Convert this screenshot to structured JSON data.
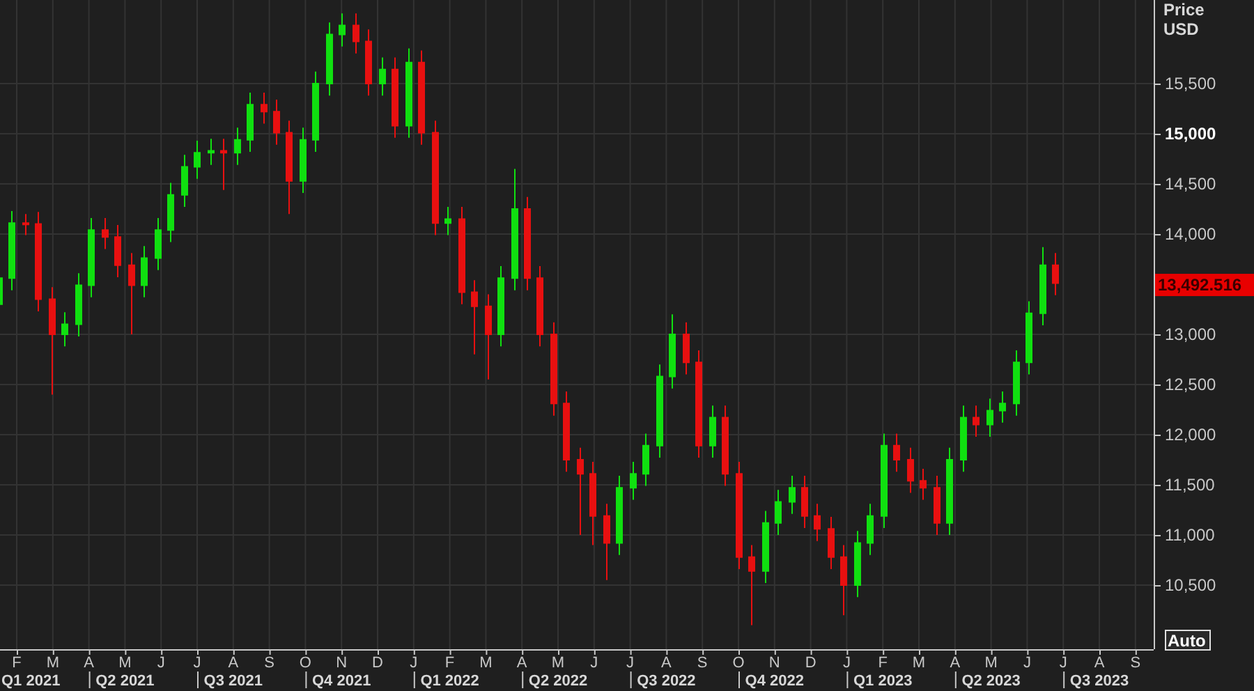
{
  "price_axis": {
    "title": "Price",
    "unit": "USD",
    "ticks": [
      {
        "label": "15,500",
        "bold": false
      },
      {
        "label": "15,000",
        "bold": true
      },
      {
        "label": "14,500",
        "bold": false
      },
      {
        "label": "14,000",
        "bold": false
      },
      {
        "label": "13,000",
        "bold": false
      },
      {
        "label": "12,500",
        "bold": false
      },
      {
        "label": "12,000",
        "bold": false
      },
      {
        "label": "11,500",
        "bold": false
      },
      {
        "label": "11,000",
        "bold": false
      },
      {
        "label": "10,500",
        "bold": false
      }
    ],
    "last_price": "13,492.516"
  },
  "time_axis": {
    "months": [
      "F",
      "M",
      "A",
      "M",
      "J",
      "J",
      "A",
      "S",
      "O",
      "N",
      "D",
      "J",
      "F",
      "M",
      "A",
      "M",
      "J",
      "J",
      "A",
      "S",
      "O",
      "N",
      "D",
      "J",
      "F",
      "M",
      "A",
      "M",
      "J",
      "J",
      "A",
      "S"
    ],
    "quarters": [
      "Q1 2021",
      "Q2 2021",
      "Q3 2021",
      "Q4 2021",
      "Q1 2022",
      "Q2 2022",
      "Q3 2022",
      "Q4 2022",
      "Q1 2023",
      "Q2 2023",
      "Q3 2023"
    ]
  },
  "auto_button": "Auto"
}
